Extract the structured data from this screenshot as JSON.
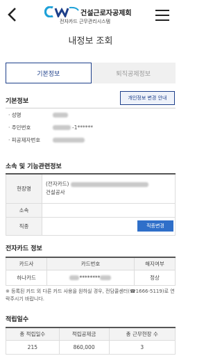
{
  "header": {
    "org_name": "건설근로자공제회",
    "system_name": "전자카드 근무관리시스템"
  },
  "page_title": "내정보 조회",
  "tabs": [
    {
      "label": "기본정보"
    },
    {
      "label": "퇴직공제정보"
    }
  ],
  "basic": {
    "section_title": "기본정보",
    "edit_button": "개인정보 변경 안내",
    "rows": [
      {
        "label": "· 성명"
      },
      {
        "label": "· 주민번호",
        "masked": "-1******"
      },
      {
        "label": "· 피공제자번호"
      }
    ]
  },
  "affiliation": {
    "section_title": "소속 및 기능관련정보",
    "site_label": "현장명",
    "site_prefix": "(전자카드)",
    "site_company": "건설공사",
    "org_label": "소속",
    "job_label": "직종",
    "job_button": "직종변경"
  },
  "card": {
    "section_title": "전자카드 정보",
    "headers": [
      "카드사",
      "카드번호",
      "해지여부"
    ],
    "row": {
      "issuer": "하나카드",
      "number_masked": "********",
      "status": "정상"
    },
    "notice": "※ 등록된 카드 외 다른 카드 사용을 원하실 경우, 전담콜센터(☎1666-5119)로 연락주시기 바랍니다."
  },
  "work": {
    "section_title": "적립일수",
    "headers": [
      "총 적립일수",
      "적립공제금",
      "총 근무현장 수"
    ],
    "row": {
      "days": "215",
      "amount": "860,000",
      "sites": "3"
    }
  },
  "colors": {
    "brand_navy": "#1d3f8a",
    "button_blue": "#2f6fc9",
    "logo_cyan": "#1ea1d8"
  },
  "icons": {
    "back": "chevron-left-icon",
    "menu": "hamburger-menu-icon"
  }
}
